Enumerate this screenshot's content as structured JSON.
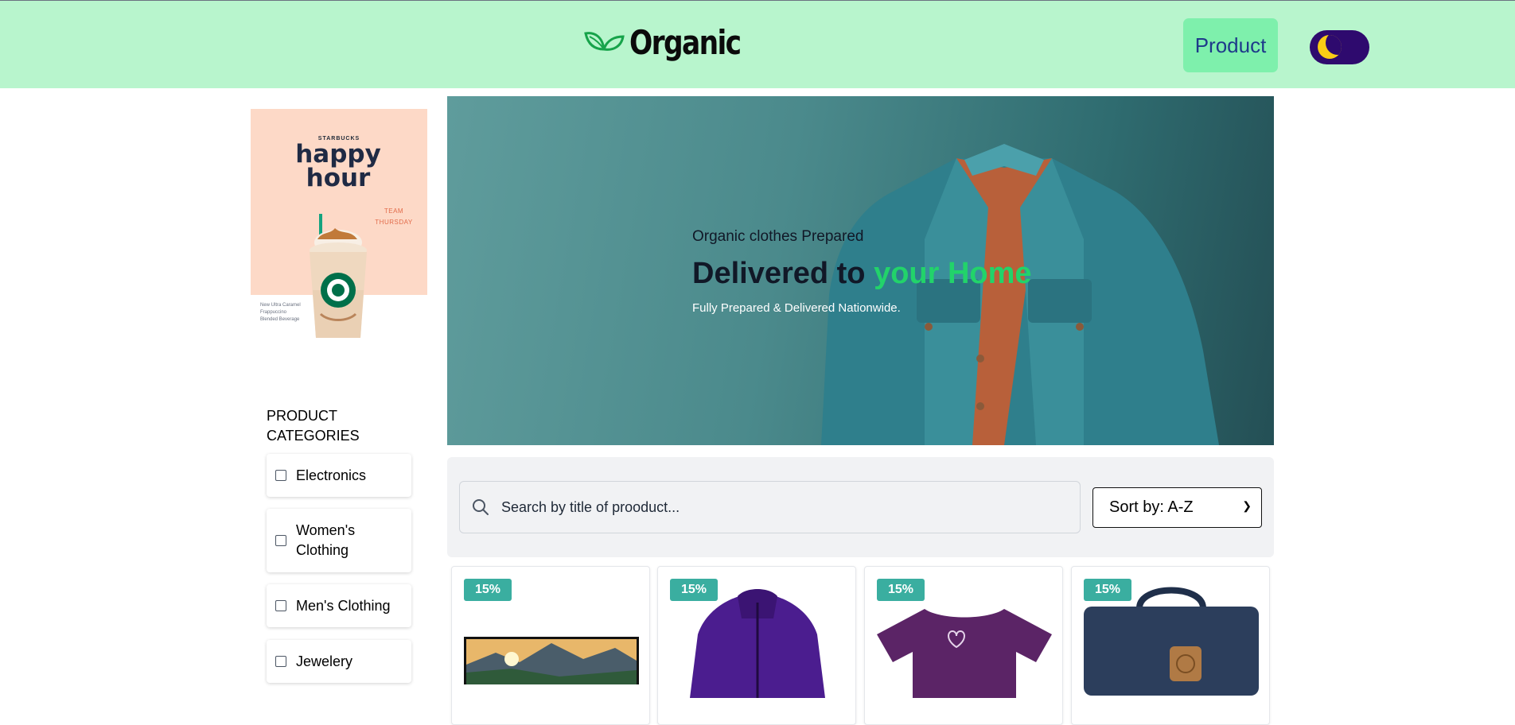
{
  "header": {
    "logo_text": "Organic",
    "product_button": "Product",
    "theme_toggle": "dark-mode"
  },
  "ad": {
    "brand": "STARBUCKS",
    "headline_line1": "happy",
    "headline_line2": "hour",
    "team_line1": "TEAM",
    "team_line2": "THURSDAY",
    "beverage_line1": "New Ultra Caramel",
    "beverage_line2": "Frappuccino",
    "beverage_line3": "Blended Beverage"
  },
  "categories": {
    "title_line1": "PRODUCT",
    "title_line2": "CATEGORIES",
    "items": [
      {
        "label": "Electronics"
      },
      {
        "label": "Women's Clothing"
      },
      {
        "label": "Men's Clothing"
      },
      {
        "label": "Jewelery"
      }
    ]
  },
  "hero": {
    "eyebrow": "Organic clothes Prepared",
    "headline_part1": "Delivered to ",
    "headline_highlight": "your Home",
    "subtext": "Fully Prepared & Delivered Nationwide."
  },
  "search": {
    "placeholder": "Search by title of prooduct...",
    "sort_selected": "Sort by: A-Z"
  },
  "products": [
    {
      "discount": "15%",
      "image": "tv-landscape"
    },
    {
      "discount": "15%",
      "image": "purple-jacket"
    },
    {
      "discount": "15%",
      "image": "purple-tshirt"
    },
    {
      "discount": "15%",
      "image": "navy-backpack"
    }
  ],
  "colors": {
    "header_bg": "#b8f5cd",
    "accent_green": "#22d36a",
    "badge": "#3aaea0",
    "toggle": "#2e0a6e"
  }
}
